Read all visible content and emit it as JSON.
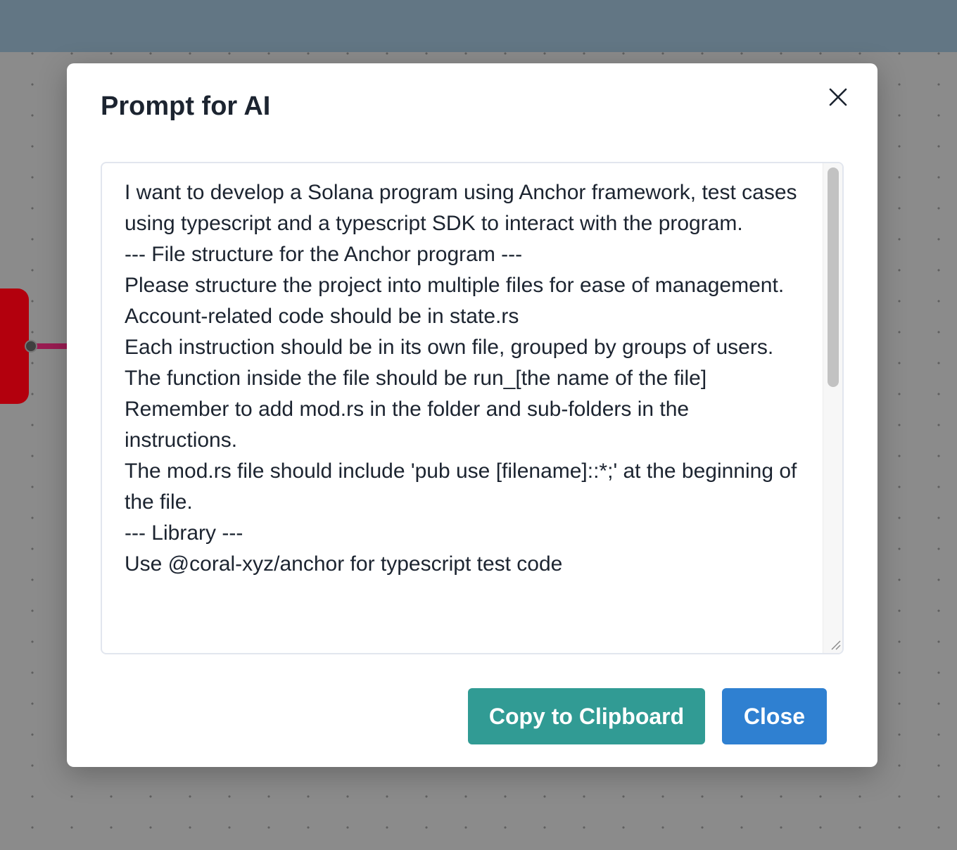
{
  "colors": {
    "topbar": "#627684",
    "canvas_background": "#8b8b8b",
    "node": "#b3000d",
    "edge": "#9a1c52",
    "copy_button": "#319b94",
    "close_button": "#2f80d1"
  },
  "modal": {
    "title": "Prompt for AI",
    "close_icon": "close-icon",
    "prompt_text": "I want to develop a Solana program using Anchor framework, test cases using typescript and a typescript SDK to interact with the program.\n--- File structure for the Anchor program ---\nPlease structure the project into multiple files for ease of management.\nAccount-related code should be in state.rs\nEach instruction should be in its own file, grouped by groups of users.\nThe function inside the file should be run_[the name of the file]\nRemember to add mod.rs in the folder and sub-folders in the instructions.\nThe mod.rs file should include 'pub use [filename]::*;' at the beginning of the file.\n--- Library ---\nUse @coral-xyz/anchor for typescript test code",
    "buttons": {
      "copy_label": "Copy to Clipboard",
      "close_label": "Close"
    }
  }
}
